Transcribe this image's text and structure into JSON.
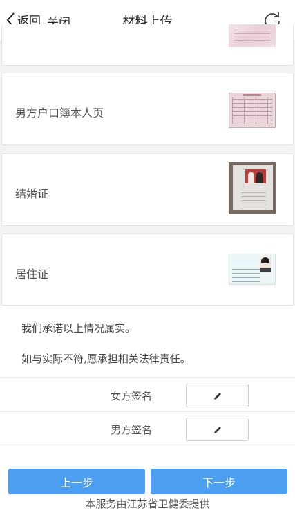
{
  "header": {
    "back_label": "返回",
    "close_label": "关闭",
    "title": "材料上传"
  },
  "materials": [
    {
      "label": "男方户口簿本人页"
    },
    {
      "label": "结婚证"
    },
    {
      "label": "居住证"
    }
  ],
  "promise": {
    "line1": "我们承诺以上情况属实。",
    "line2": "如与实际不符,愿承担相关法律责任。"
  },
  "signatures": {
    "female_label": "女方签名",
    "male_label": "男方签名"
  },
  "buttons": {
    "prev_label": "上一步",
    "next_label": "下一步"
  },
  "footer": {
    "provider": "本服务由江苏省卫健委提供"
  },
  "colors": {
    "primary": "#4c9ef0",
    "background": "#f2f2f4"
  },
  "icons": [
    "chevron-left-icon",
    "refresh-icon",
    "pencil-icon"
  ]
}
